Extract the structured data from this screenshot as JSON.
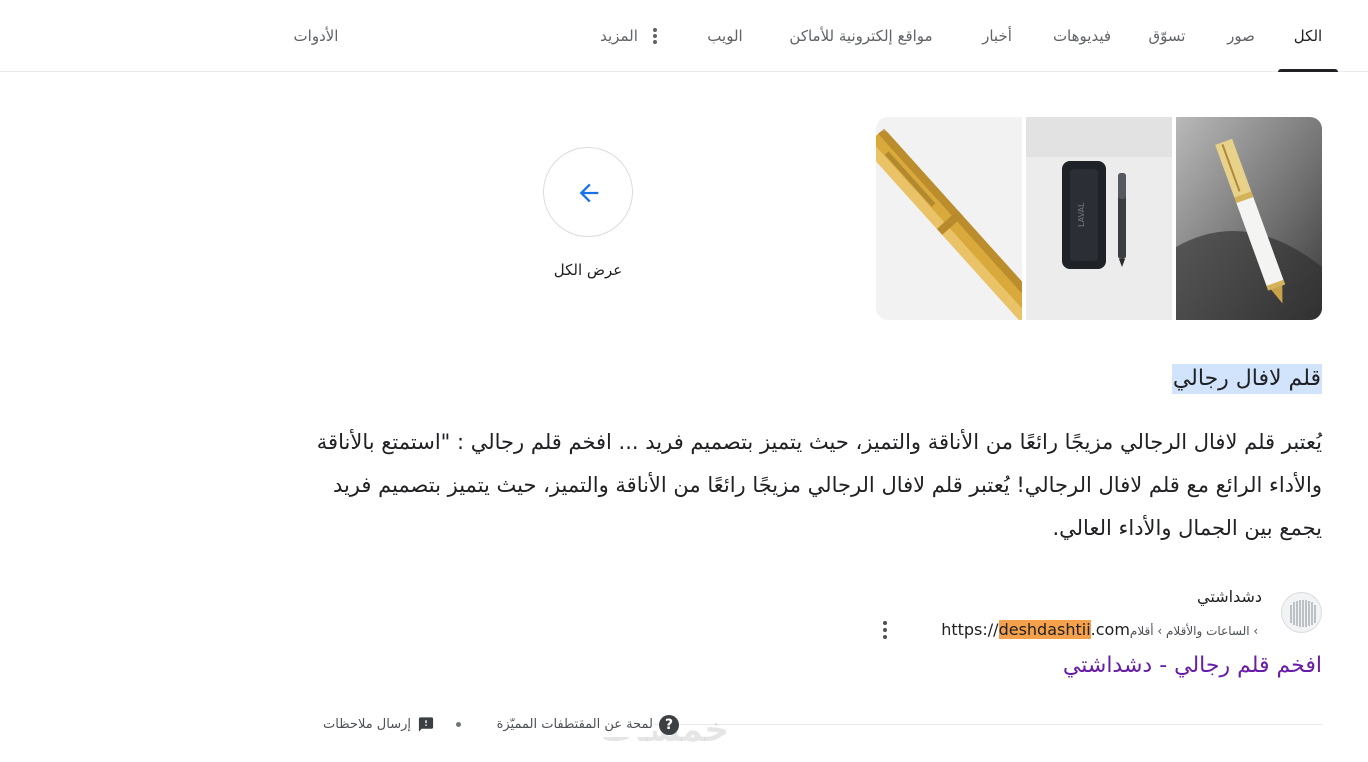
{
  "tabs": [
    {
      "label": "الكل",
      "active": true
    },
    {
      "label": "صور"
    },
    {
      "label": "تسوّق"
    },
    {
      "label": "فيديوهات"
    },
    {
      "label": "أخبار"
    },
    {
      "label": "مواقع إلكترونية للأماكن"
    },
    {
      "label": "الويب"
    },
    {
      "label": "المزيد"
    }
  ],
  "tools_label": "الأدوات",
  "view_all_label": "عرض الكل",
  "snippet": {
    "title": "قلم لافال رجالي",
    "text": "يُعتبر قلم لافال الرجالي مزيجًا رائعًا من الأناقة والتميز، حيث يتميز بتصميم فريد ... افخم قلم رجالي : \"استمتع بالأناقة والأداء الرائع مع قلم لافال الرجالي! يُعتبر قلم لافال الرجالي مزيجًا رائعًا من الأناقة والتميز، حيث يتميز بتصميم فريد يجمع بين الجمال والأداء العالي."
  },
  "source": {
    "site_name": "دشداشتي",
    "url_prefix": "https://",
    "url_highlight": "deshdashtii",
    "url_suffix": ".com",
    "breadcrumb": " › الساعات والأقلام › أقلام",
    "link_title": "افخم قلم رجالي - دشداشتي"
  },
  "footer": {
    "about_label": "لمحة عن المقتطفات المميّزة",
    "feedback_label": "إرسال ملاحظات",
    "watermark": "خمسات"
  },
  "colors": {
    "accent_blue": "#1a73e8",
    "visited_link": "#681da8",
    "title_highlight": "#d2e3fc",
    "url_highlight": "#f5a04a"
  }
}
